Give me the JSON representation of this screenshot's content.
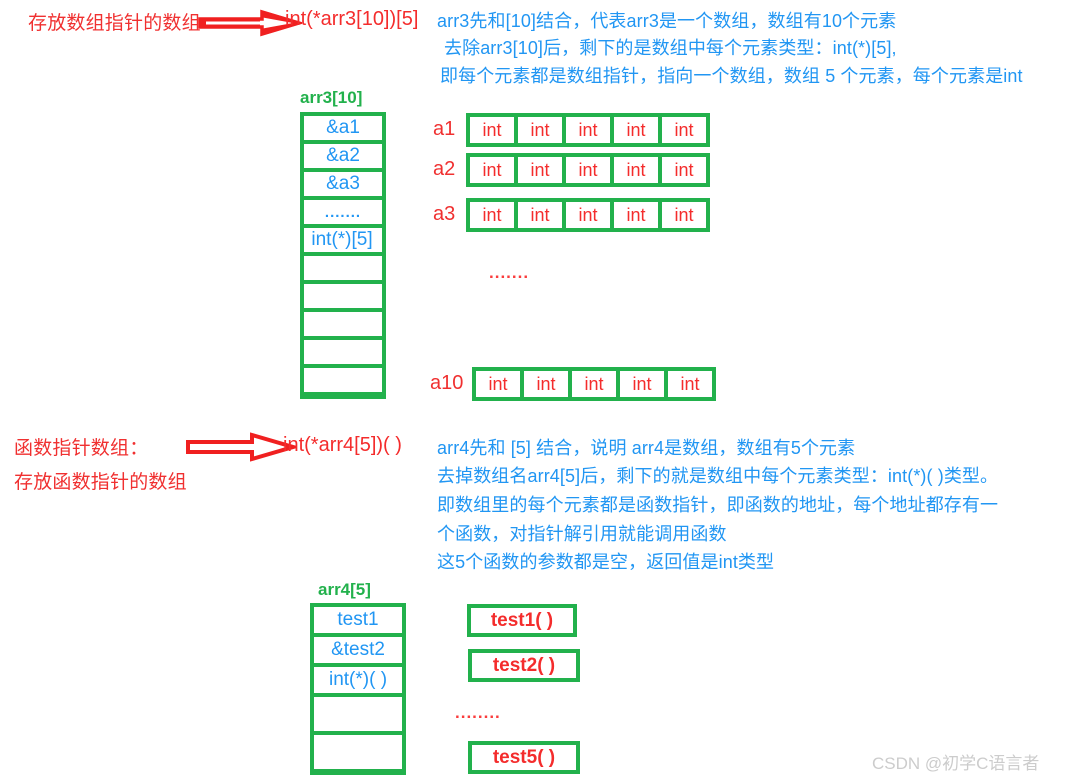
{
  "diagram": {
    "top_section": {
      "left_label": "存放数组指针的数组",
      "arrow_icon": "block-arrow-right-icon",
      "declaration": "int(*arr3[10])[5]",
      "explanation_lines": [
        "arr3先和[10]结合，代表arr3是一个数组，数组有10个元素",
        "去除arr3[10]后，剩下的是数组中每个元素类型：int(*)[5],",
        "即每个元素都是数组指针，指向一个数组，数组 5 个元素，每个元素是int"
      ],
      "array_title": "arr3[10]",
      "array_cells": [
        "&a1",
        "&a2",
        "&a3",
        ".......",
        "int(*)[5]",
        "",
        "",
        "",
        "",
        ""
      ],
      "rows": [
        {
          "label": "a1",
          "cells": [
            "int",
            "int",
            "int",
            "int",
            "int"
          ]
        },
        {
          "label": "a2",
          "cells": [
            "int",
            "int",
            "int",
            "int",
            "int"
          ]
        },
        {
          "label": "a3",
          "cells": [
            "int",
            "int",
            "int",
            "int",
            "int"
          ]
        }
      ],
      "rows_ellipsis": ".......",
      "last_row": {
        "label": "a10",
        "cells": [
          "int",
          "int",
          "int",
          "int",
          "int"
        ]
      }
    },
    "bottom_section": {
      "left_label_line1": "函数指针数组：",
      "left_label_line2": "存放函数指针的数组",
      "arrow_icon": "block-arrow-right-icon",
      "declaration": "int(*arr4[5])( )",
      "explanation_lines": [
        "arr4先和 [5] 结合，说明 arr4是数组，数组有5个元素",
        "去掉数组名arr4[5]后，剩下的就是数组中每个元素类型：int(*)( )类型。",
        "即数组里的每个元素都是函数指针，即函数的地址，每个地址都存有一",
        "个函数，对指针解引用就能调用函数",
        "这5个函数的参数都是空，返回值是int类型"
      ],
      "array_title": "arr4[5]",
      "array_cells": [
        "test1",
        "&test2",
        "int(*)( )",
        "",
        ""
      ],
      "function_boxes": [
        "test1( )",
        "test2( )",
        "test5( )"
      ],
      "functions_ellipsis": "........"
    },
    "watermark": "CSDN @初学C语言者",
    "colors": {
      "red": "#f03030",
      "blue": "#2196f3",
      "green": "#22b14c",
      "watermark_gray": "#cccccc"
    }
  }
}
